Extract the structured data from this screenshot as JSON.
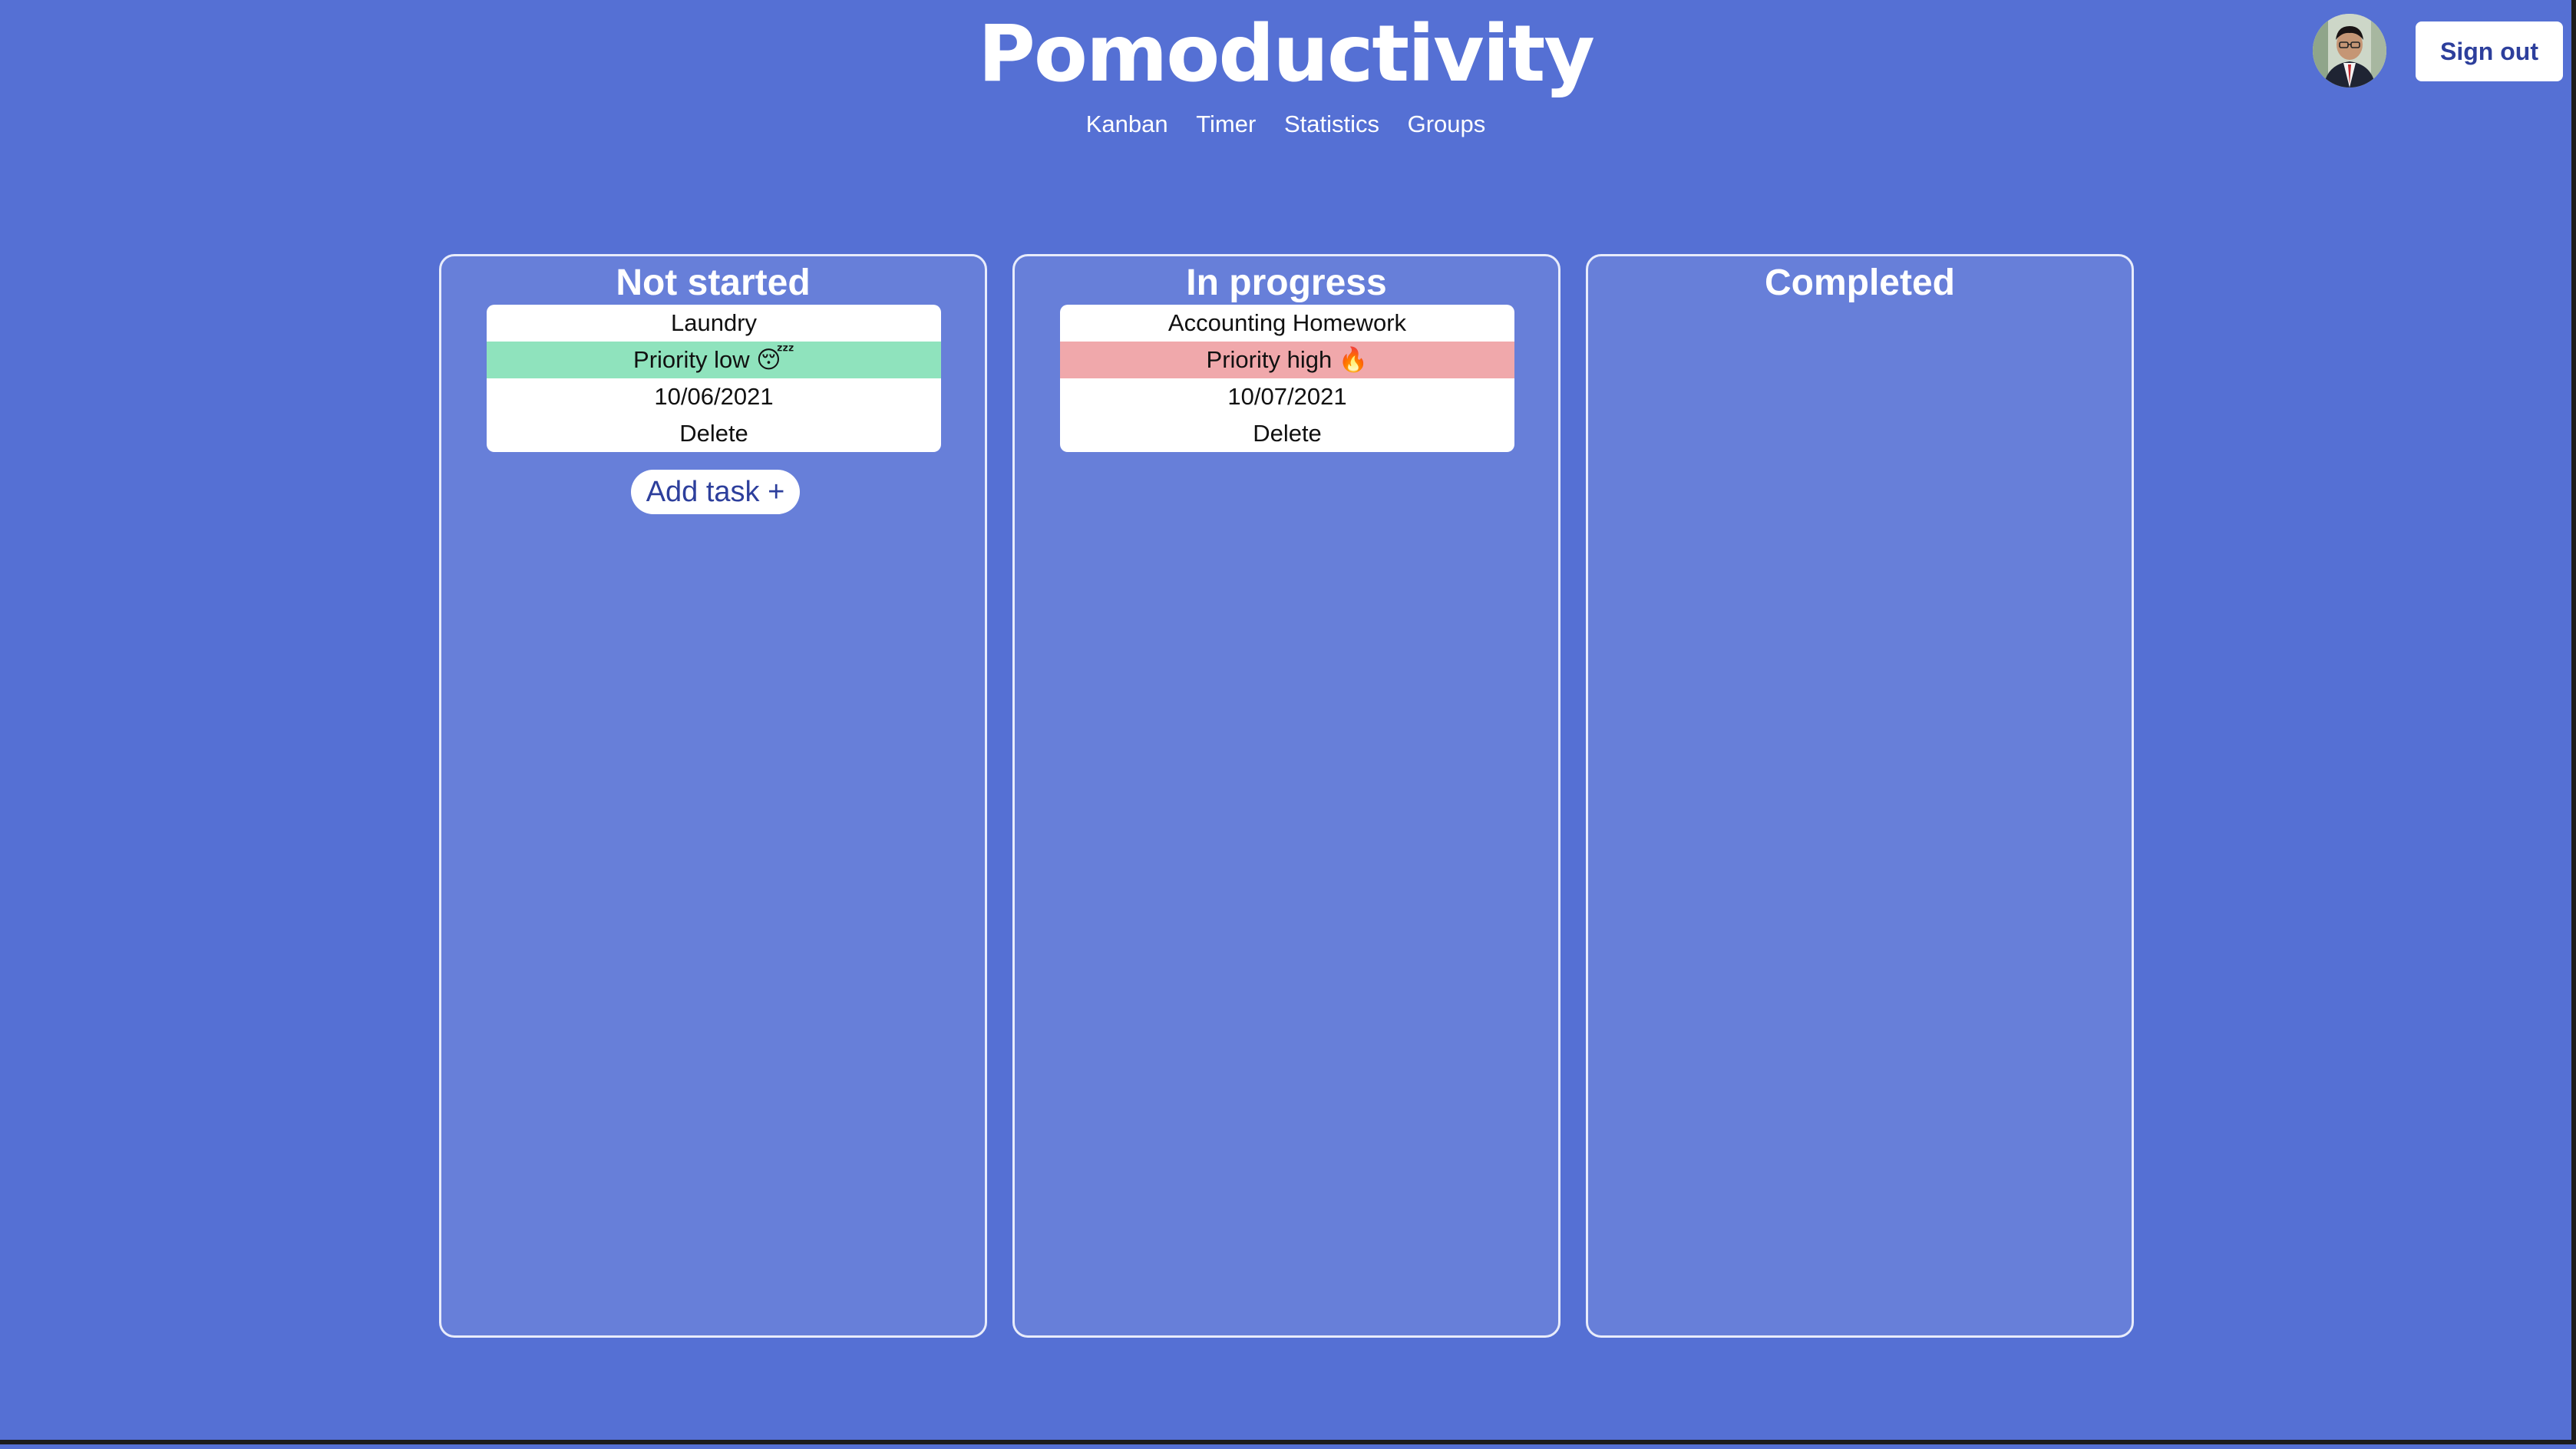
{
  "app": {
    "title": "Pomoductivity"
  },
  "nav": {
    "items": [
      "Kanban",
      "Timer",
      "Statistics",
      "Groups"
    ]
  },
  "header": {
    "sign_out_label": "Sign out"
  },
  "colors": {
    "background": "#5570d4",
    "column_background": "#677fd9",
    "priority_low": "#8fe3bd",
    "priority_high": "#f0a8ab",
    "button_text": "#2d3f9c"
  },
  "board": {
    "columns": [
      {
        "title": "Not started",
        "tasks": [
          {
            "name": "Laundry",
            "priority": "Priority low 😴",
            "date": "10/06/2021",
            "delete_label": "Delete"
          }
        ],
        "add_label": "Add task +"
      },
      {
        "title": "In progress",
        "tasks": [
          {
            "name": "Accounting Homework",
            "priority": "Priority high 🔥",
            "date": "10/07/2021",
            "delete_label": "Delete"
          }
        ]
      },
      {
        "title": "Completed",
        "tasks": []
      }
    ]
  }
}
